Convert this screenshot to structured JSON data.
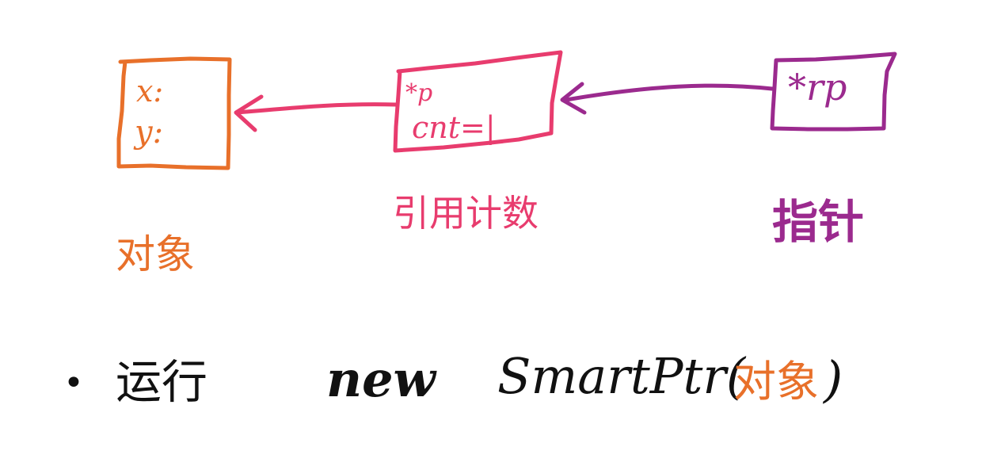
{
  "colors": {
    "object": "#e8702a",
    "refcount": "#e83c6e",
    "pointer": "#9b2a8e",
    "ink": "#111111"
  },
  "object_box": {
    "field_x": "x:",
    "field_y": "y:",
    "caption": "对象"
  },
  "refcount_box": {
    "field_ptr": "*p",
    "field_cnt": "cnt=|",
    "caption": "引用计数"
  },
  "pointer_box": {
    "field_rp": "*rp",
    "caption": "指针"
  },
  "bottom_line": {
    "bullet": "•",
    "verb": "运行",
    "keyword": "new",
    "call": "SmartPtr(",
    "arg": "对象",
    "close": ")"
  }
}
